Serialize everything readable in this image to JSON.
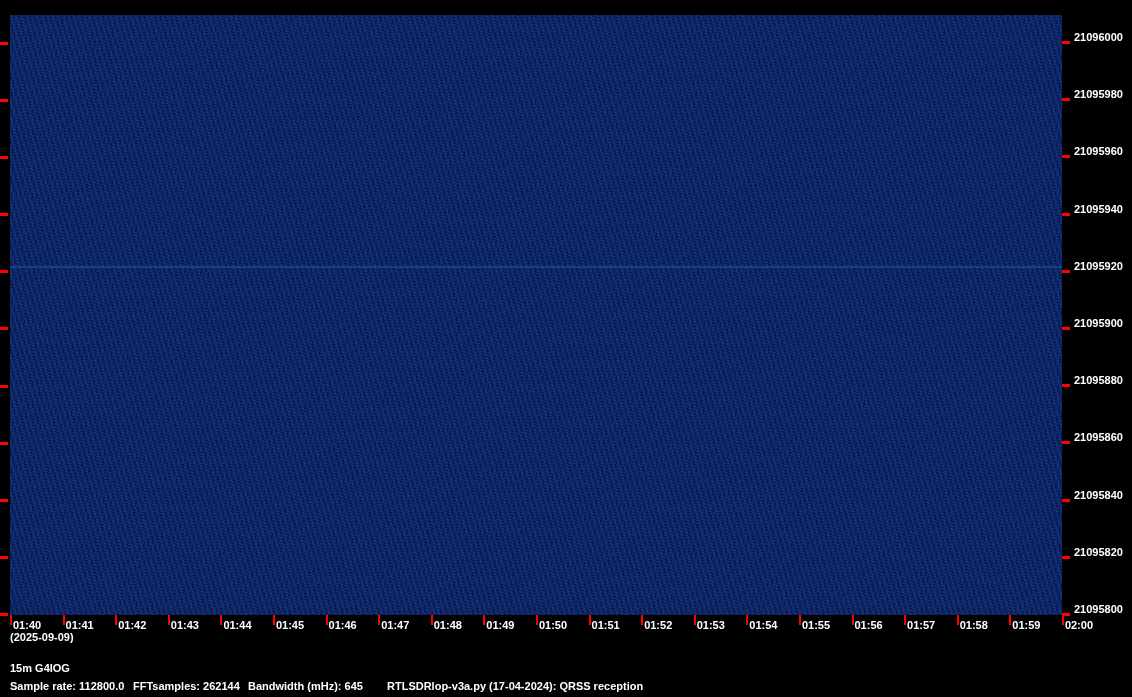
{
  "waterfall": {
    "frequency_labels": [
      "21096000",
      "21095980",
      "21095960",
      "21095940",
      "21095920",
      "21095900",
      "21095880",
      "21095860",
      "21095840",
      "21095820",
      "21095800"
    ],
    "time_labels": [
      "01:40",
      "01:41",
      "01:42",
      "01:43",
      "01:44",
      "01:45",
      "01:46",
      "01:47",
      "01:48",
      "01:49",
      "01:50",
      "01:51",
      "01:52",
      "01:53",
      "01:54",
      "01:55",
      "01:56",
      "01:57",
      "01:58",
      "01:59",
      "02:00"
    ],
    "date": "(2025-09-09)"
  },
  "station": "15m G4IOG",
  "footer": [
    "Sample rate: 112800.0",
    "FFTsamples: 262144",
    "Bandwidth (mHz): 645",
    "RTLSDRlop-v3a.py (17-04-2024): QRSS reception"
  ]
}
